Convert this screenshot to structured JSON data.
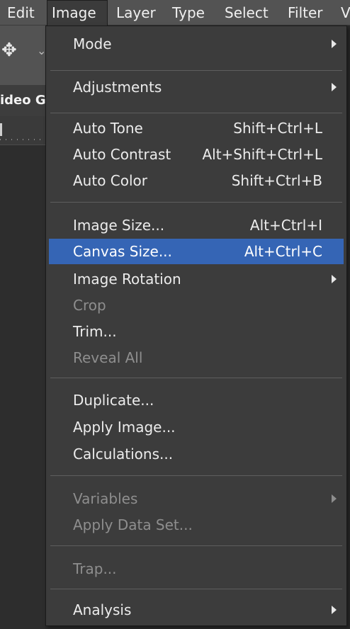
{
  "menubar": {
    "items": [
      {
        "label": "Edit"
      },
      {
        "label": "Image"
      },
      {
        "label": "Layer"
      },
      {
        "label": "Type"
      },
      {
        "label": "Select"
      },
      {
        "label": "Filter"
      },
      {
        "label": "V"
      }
    ],
    "active": "Image"
  },
  "left": {
    "tab_label": "ideo G",
    "tool_icon": "move-icon"
  },
  "menu": {
    "items": [
      {
        "label": "Mode",
        "submenu": true
      },
      {
        "label": "Adjustments",
        "submenu": true
      },
      {
        "label": "Auto Tone",
        "shortcut": "Shift+Ctrl+L"
      },
      {
        "label": "Auto Contrast",
        "shortcut": "Alt+Shift+Ctrl+L"
      },
      {
        "label": "Auto Color",
        "shortcut": "Shift+Ctrl+B"
      },
      {
        "label": "Image Size...",
        "shortcut": "Alt+Ctrl+I"
      },
      {
        "label": "Canvas Size...",
        "shortcut": "Alt+Ctrl+C",
        "highlighted": true
      },
      {
        "label": "Image Rotation",
        "submenu": true
      },
      {
        "label": "Crop",
        "disabled": true
      },
      {
        "label": "Trim..."
      },
      {
        "label": "Reveal All",
        "disabled": true
      },
      {
        "label": "Duplicate..."
      },
      {
        "label": "Apply Image..."
      },
      {
        "label": "Calculations..."
      },
      {
        "label": "Variables",
        "submenu": true,
        "disabled": true
      },
      {
        "label": "Apply Data Set...",
        "disabled": true
      },
      {
        "label": "Trap...",
        "disabled": true
      },
      {
        "label": "Analysis",
        "submenu": true
      }
    ]
  },
  "colors": {
    "menubar_bg": "#535353",
    "menu_bg": "#3c3c3c",
    "highlight": "#3565b5",
    "disabled_text": "#8e8e8e"
  }
}
